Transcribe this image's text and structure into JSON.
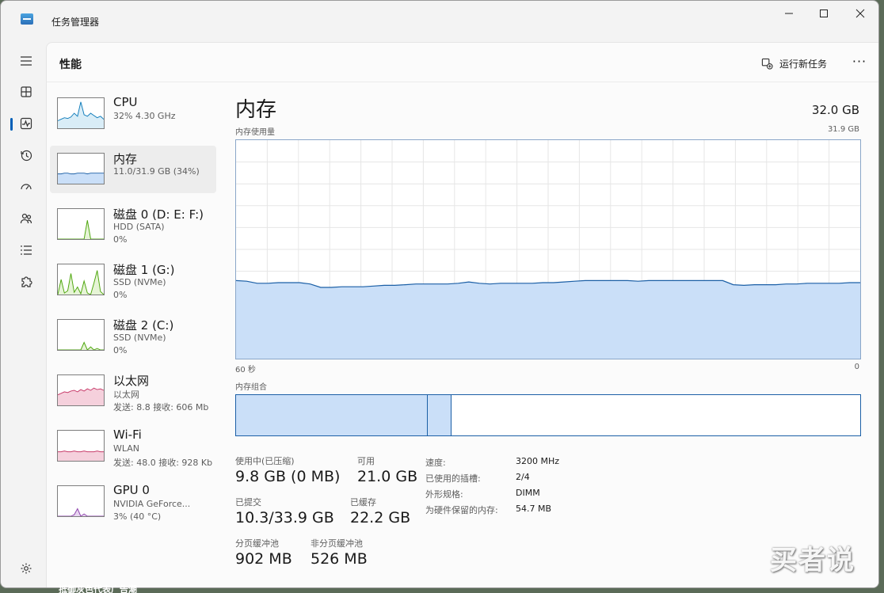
{
  "app": {
    "title": "任务管理器"
  },
  "header": {
    "page_title": "性能",
    "run_task_label": "运行新任务",
    "more_label": "···"
  },
  "sidebar": [
    {
      "name": "CPU",
      "line1": "32% 4.30 GHz",
      "line2": "",
      "icon": "cpu-graph",
      "color": "#117dbb",
      "fill": "#d9edf7"
    },
    {
      "name": "内存",
      "line1": "11.0/31.9 GB (34%)",
      "line2": "",
      "icon": "memory-graph",
      "color": "#1b5fa6",
      "fill": "#cadff8"
    },
    {
      "name": "磁盘 0 (D: E: F:)",
      "line1": "HDD (SATA)",
      "line2": "0%",
      "icon": "disk-graph",
      "color": "#4da60c",
      "fill": "#e6f4d6"
    },
    {
      "name": "磁盘 1 (G:)",
      "line1": "SSD (NVMe)",
      "line2": "0%",
      "icon": "disk-graph",
      "color": "#4da60c",
      "fill": "#e6f4d6"
    },
    {
      "name": "磁盘 2 (C:)",
      "line1": "SSD (NVMe)",
      "line2": "0%",
      "icon": "disk-graph",
      "color": "#4da60c",
      "fill": "#e6f4d6"
    },
    {
      "name": "以太网",
      "line1": "以太网",
      "line2": "发送: 8.8 接收: 606 Mb",
      "icon": "network-graph",
      "color": "#c83b6a",
      "fill": "#f5d0dc"
    },
    {
      "name": "Wi-Fi",
      "line1": "WLAN",
      "line2": "发送: 48.0 接收: 928 Kb",
      "icon": "network-graph",
      "color": "#c83b6a",
      "fill": "#f5d0dc"
    },
    {
      "name": "GPU 0",
      "line1": "NVIDIA GeForce...",
      "line2": "3% (40 °C)",
      "icon": "gpu-graph",
      "color": "#8e44ad",
      "fill": "#e8d5f0"
    }
  ],
  "main": {
    "title": "内存",
    "total": "32.0 GB",
    "usage_label": "内存使用量",
    "max_label": "31.9 GB",
    "time_left": "60 秒",
    "time_right": "0",
    "composition_label": "内存组合",
    "stats": [
      {
        "label": "使用中(已压缩)",
        "value": "9.8 GB (0 MB)"
      },
      {
        "label": "可用",
        "value": "21.0 GB"
      },
      {
        "label": "已提交",
        "value": "10.3/33.9 GB"
      },
      {
        "label": "已缓存",
        "value": "22.2 GB"
      },
      {
        "label": "分页缓冲池",
        "value": "902 MB"
      },
      {
        "label": "非分页缓冲池",
        "value": "526 MB"
      }
    ],
    "specs": [
      {
        "label": "速度:",
        "value": "3200 MHz"
      },
      {
        "label": "已使用的插槽:",
        "value": "2/4"
      },
      {
        "label": "外形规格:",
        "value": "DIMM"
      },
      {
        "label": "为硬件保留的内存:",
        "value": "54.7 MB"
      }
    ]
  },
  "chart_data": {
    "type": "area",
    "ylim": [
      0,
      31.9
    ],
    "series": [
      {
        "values": [
          11.4,
          11.3,
          11.0,
          11.0,
          11.1,
          11.1,
          11.1,
          10.9,
          10.4,
          10.4,
          10.5,
          10.5,
          10.5,
          10.6,
          10.7,
          10.7,
          10.8,
          10.9,
          10.9,
          10.9,
          10.9,
          11.0,
          11.2,
          11.0,
          10.9,
          11.0,
          11.0,
          11.0,
          11.0,
          11.1,
          11.1,
          11.2,
          11.3,
          11.4,
          11.4,
          11.4,
          11.4,
          11.4,
          11.3,
          11.4,
          11.4,
          11.4,
          11.4,
          11.4,
          11.4,
          11.4,
          11.4,
          10.8,
          10.7,
          10.8,
          10.8,
          10.8,
          10.9,
          10.9,
          11.0,
          11.0,
          11.0,
          11.0,
          11.1,
          11.1
        ]
      }
    ]
  },
  "composition": {
    "in_use_fraction": 0.307,
    "modified_fraction": 0.038
  },
  "watermark": "买者说",
  "bottom_caption": "抵御灰色代表广告潮"
}
